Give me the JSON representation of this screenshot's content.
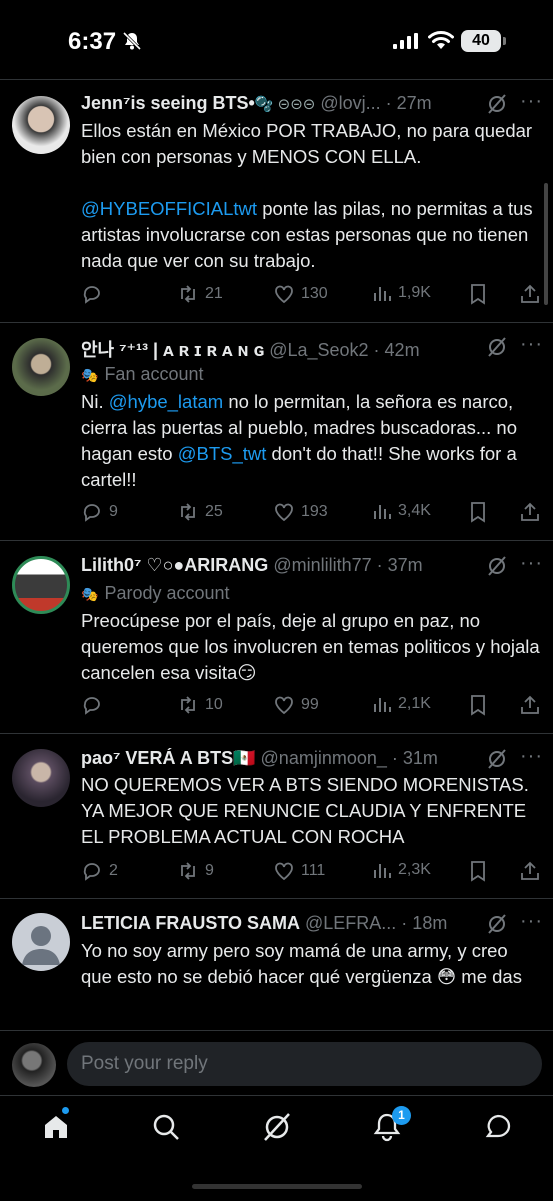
{
  "status": {
    "time": "6:37",
    "battery": "40"
  },
  "tweets": [
    {
      "name": "Jenn⁷is seeing BTS•",
      "name_emoji": "🫧 ⊝⊝⊝",
      "handle": "@lovj... · 27m",
      "badge": "",
      "text_parts": [
        "Ellos están en México POR TRABAJO, no para quedar bien con personas y MENOS CON ELLA.",
        "@HYBEOFFICIALtwt",
        " ponte las pilas, no permitas a tus artistas involucrarse con estas personas que no tienen nada que ver con su trabajo."
      ],
      "replies": "",
      "reposts": "21",
      "likes": "130",
      "views": "1,9K"
    },
    {
      "name": "안나 ⁷⁺¹³ | ᴀ ʀ ɪ ʀ ᴀ ɴ ɢ",
      "handle": "@La_Seok2 · 42m",
      "badge": "Fan account",
      "text_parts": [
        "Ni. ",
        "@hybe_latam",
        " no lo permitan, la señora es narco, cierra las puertas al pueblo, madres buscadoras... no hagan esto ",
        "@BTS_twt",
        " don't do that!! She works for a cartel!!"
      ],
      "replies": "9",
      "reposts": "25",
      "likes": "193",
      "views": "3,4K"
    },
    {
      "name": "Lilith0⁷ ♡○●ARIRANG",
      "handle": "@minlilith77 · 37m",
      "badge": "Parody account",
      "text": "Preocúpese por el país, deje al grupo en paz, no queremos que los involucren en temas politicos y hojala cancelen esa visita😏",
      "replies": "",
      "reposts": "10",
      "likes": "99",
      "views": "2,1K"
    },
    {
      "name": "pao⁷ VERÁ A BTS🇲🇽",
      "handle": "@namjinmoon_ · 31m",
      "badge": "",
      "text": "NO QUEREMOS VER A BTS SIENDO MORENISTAS. YA MEJOR QUE RENUNCIE CLAUDIA Y ENFRENTE EL PROBLEMA ACTUAL CON ROCHA",
      "replies": "2",
      "reposts": "9",
      "likes": "111",
      "views": "2,3K"
    },
    {
      "name": "LETICIA FRAUSTO SAMA",
      "handle": "@LEFRA... · 18m",
      "badge": "",
      "text": "Yo no soy army pero soy mamá de una army, y creo que esto no se debió hacer qué vergüenza 😳 me das"
    }
  ],
  "reply": {
    "placeholder": "Post your reply"
  },
  "tabs": {
    "notifications_count": "1"
  },
  "colors": {
    "accent": "#1d9bf0",
    "muted": "#71767b",
    "bg": "#000000"
  }
}
